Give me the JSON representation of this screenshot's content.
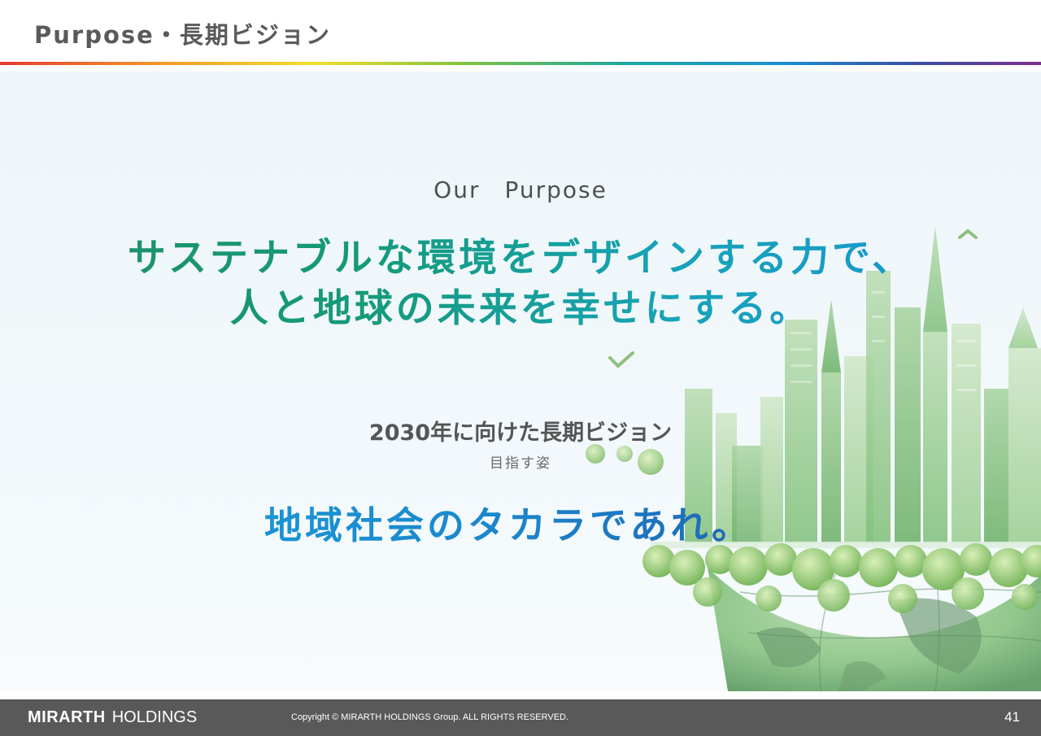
{
  "header": {
    "title": "Purpose・長期ビジョン"
  },
  "purpose": {
    "label": "Our　Purpose",
    "line1": "サステナブルな環境をデザインする力で、",
    "line2": "人と地球の未来を幸せにする。"
  },
  "vision": {
    "title": "2030年に向けた長期ビジョン",
    "subtitle": "目指す姿",
    "statement": "地域社会のタカラであれ。"
  },
  "illustration": {
    "icon": "green-city-globe-illustration"
  },
  "footer": {
    "logo_strong": "MIRARTH",
    "logo_light": "HOLDINGS",
    "copyright": "Copyright © MIRARTH HOLDINGS Group. ALL RIGHTS RESERVED.",
    "page_number": "41"
  },
  "colors": {
    "purpose_gradient_start": "#1f8f62",
    "purpose_gradient_end": "#1b93d8",
    "vision_gradient_start": "#1aa2dd",
    "vision_gradient_end": "#24479a",
    "footer_bg": "#595959"
  }
}
